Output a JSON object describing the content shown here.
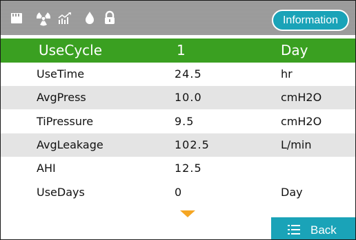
{
  "status_bar": {
    "icons": [
      "sd-card-icon",
      "radiation-icon",
      "chart-trend-icon",
      "water-drop-icon",
      "lock-icon"
    ],
    "information_label": "Information"
  },
  "header": {
    "label": "UseCycle",
    "value": "1",
    "unit": "Day",
    "color": "#3aa021"
  },
  "rows": [
    {
      "label": "UseTime",
      "value": "24.5",
      "unit": "hr"
    },
    {
      "label": "AvgPress",
      "value": "10.0",
      "unit": "cmH2O"
    },
    {
      "label": "TiPressure",
      "value": "9.5",
      "unit": "cmH2O"
    },
    {
      "label": "AvgLeakage",
      "value": "102.5",
      "unit": "L/min"
    },
    {
      "label": "AHI",
      "value": "12.5",
      "unit": ""
    },
    {
      "label": "UseDays",
      "value": "0",
      "unit": "Day"
    }
  ],
  "footer": {
    "more_indicator": "chevron-down-icon",
    "back_label": "Back",
    "accent": "#1aa3b8",
    "indicator_color": "#f5a623"
  }
}
